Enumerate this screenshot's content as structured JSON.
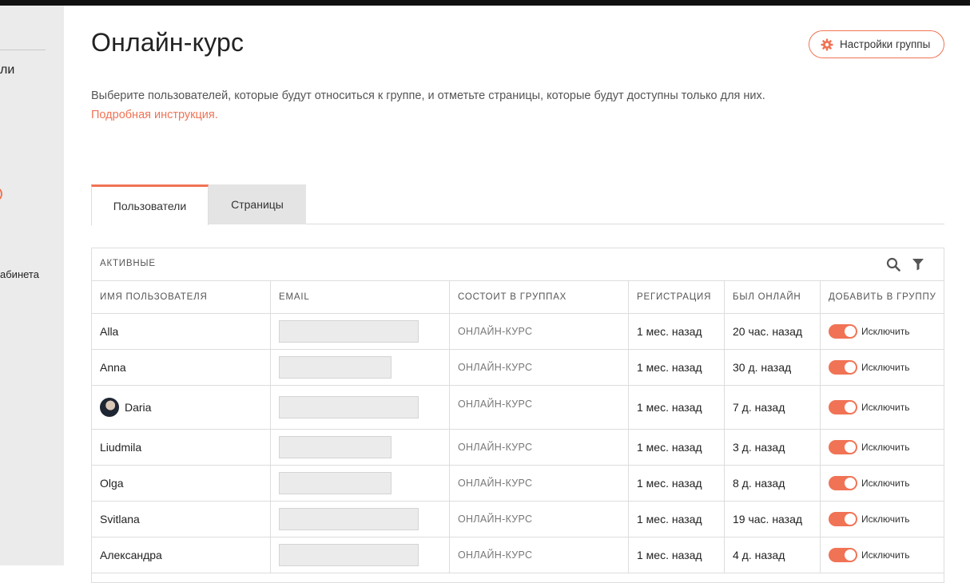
{
  "sidebar": {
    "fragment_top": "ли",
    "fragment_bottom": "абинета"
  },
  "page": {
    "title": "Онлайн-курс",
    "settings_label": "Настройки группы",
    "description": "Выберите пользователей, которые будут относиться к группе, и отметьте страницы, которые будут доступны только для них.",
    "description_link": "Подробная инструкция."
  },
  "tabs": [
    {
      "label": "Пользователи"
    },
    {
      "label": "Страницы"
    }
  ],
  "table": {
    "caption": "АКТИВНЫЕ",
    "columns": [
      "ИМЯ ПОЛЬЗОВАТЕЛЯ",
      "EMAIL",
      "СОСТОИТ В ГРУППАХ",
      "РЕГИСТРАЦИЯ",
      "БЫЛ ОНЛАЙН",
      "ДОБАВИТЬ В ГРУППУ"
    ],
    "rows": [
      {
        "name": "Alla",
        "group": "ОНЛАЙН-КУРС",
        "registered": "1 мес. назад",
        "online": "20 час. назад",
        "action": "Исключить"
      },
      {
        "name": "Anna",
        "group": "ОНЛАЙН-КУРС",
        "registered": "1 мес. назад",
        "online": "30 д. назад",
        "action": "Исключить"
      },
      {
        "name": "Daria",
        "group": "ОНЛАЙН-КУРС",
        "registered": "1 мес. назад",
        "online": "7 д. назад",
        "action": "Исключить"
      },
      {
        "name": "Liudmila",
        "group": "ОНЛАЙН-КУРС",
        "registered": "1 мес. назад",
        "online": "3 д. назад",
        "action": "Исключить"
      },
      {
        "name": "Olga",
        "group": "ОНЛАЙН-КУРС",
        "registered": "1 мес. назад",
        "online": "8 д. назад",
        "action": "Исключить"
      },
      {
        "name": "Svitlana",
        "group": "ОНЛАЙН-КУРС",
        "registered": "1 мес. назад",
        "online": "19 час. назад",
        "action": "Исключить"
      },
      {
        "name": "Александра",
        "group": "ОНЛАЙН-КУРС",
        "registered": "1 мес. назад",
        "online": "4 д. назад",
        "action": "Исключить"
      }
    ]
  },
  "colors": {
    "accent": "#f07355",
    "sidebar_bg": "#ebebeb",
    "inactive_tab": "#e4e4e4"
  }
}
